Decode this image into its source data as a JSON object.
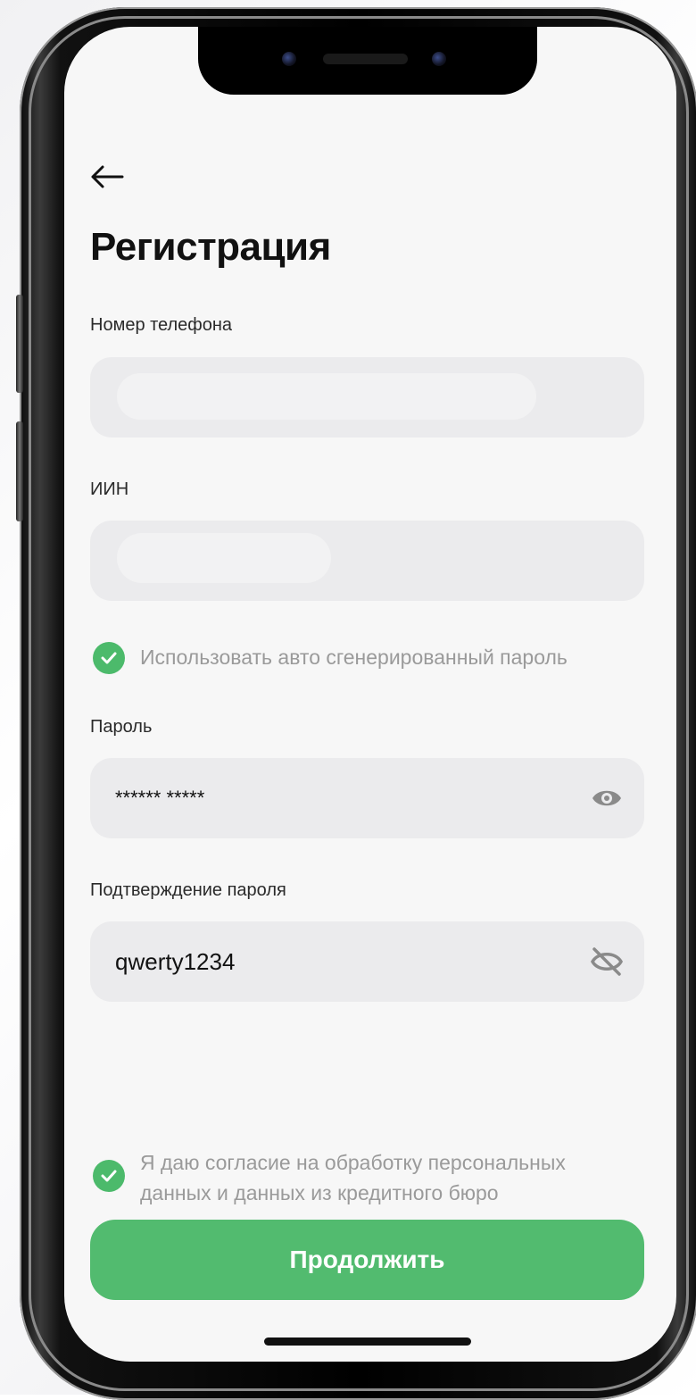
{
  "screen": {
    "title": "Регистрация"
  },
  "fields": {
    "phone": {
      "label": "Номер телефона",
      "value": ""
    },
    "iin": {
      "label": "ИИН",
      "value": ""
    },
    "password": {
      "label": "Пароль",
      "value": "****** *****",
      "visibility_icon": "eye-icon"
    },
    "password_confirm": {
      "label": "Подтверждение пароля",
      "value": "qwerty1234",
      "visibility_icon": "eye-off-icon"
    }
  },
  "options": {
    "auto_password": {
      "label": "Использовать авто сгенерированный пароль",
      "checked": true
    },
    "consent": {
      "label": "Я даю согласие на обработку персональных данных и данных из кредитного бюро",
      "checked": true
    }
  },
  "actions": {
    "continue_label": "Продолжить"
  },
  "colors": {
    "accent": "#52bb6f",
    "field_bg": "#ebebed",
    "screen_bg": "#f7f7f7"
  }
}
